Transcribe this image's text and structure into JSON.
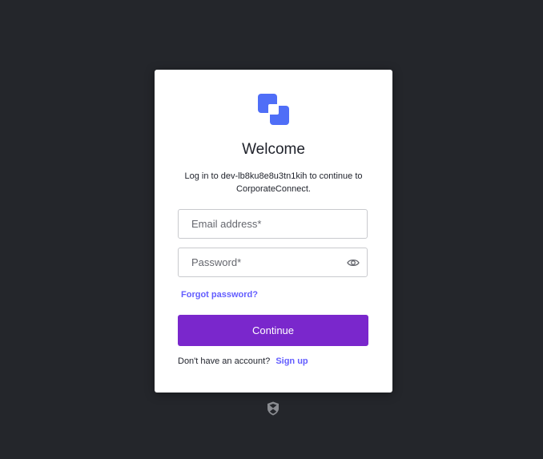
{
  "login": {
    "title": "Welcome",
    "subtitle": "Log in to dev-lb8ku8e8u3tn1kih to continue to CorporateConnect.",
    "email": {
      "placeholder": "Email address*",
      "value": ""
    },
    "password": {
      "placeholder": "Password*",
      "value": "",
      "toggle_icon": "eye-icon"
    },
    "forgot_password_label": "Forgot password?",
    "continue_label": "Continue",
    "signup_prompt": "Don't have an account?",
    "signup_label": "Sign up"
  },
  "icons": {
    "logo": "overlapping-squares-logo",
    "footer": "shield-icon"
  },
  "colors": {
    "background": "#24262b",
    "card": "#ffffff",
    "accent_link": "#635dff",
    "button": "#7a27cc",
    "logo": "#4f6ef7"
  }
}
